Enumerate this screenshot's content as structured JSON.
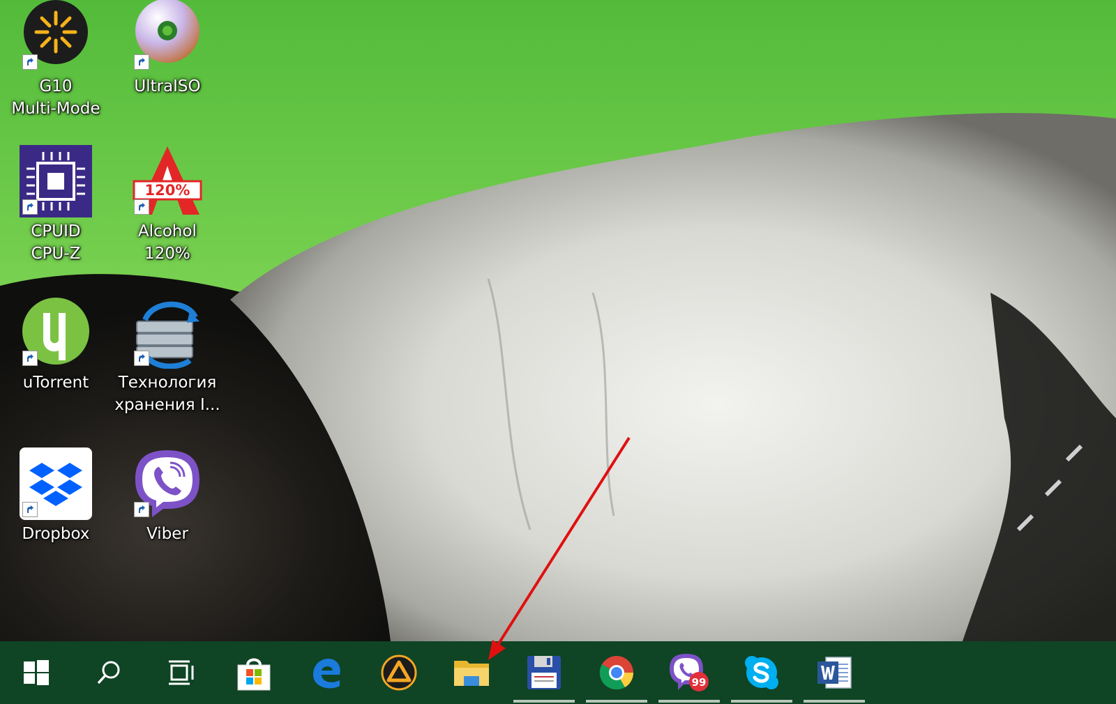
{
  "desktop_icons": [
    {
      "label": "G10\nMulti-Mode",
      "icon": "g10-multimode-icon"
    },
    {
      "label": "UltraISO",
      "icon": "ultraiso-disc-icon"
    },
    {
      "label": "CPUID\nCPU-Z",
      "icon": "cpuz-chip-icon"
    },
    {
      "label": "Alcohol\n120%",
      "icon": "alcohol-120-icon"
    },
    {
      "label": "uTorrent",
      "icon": "utorrent-icon"
    },
    {
      "label": "Технология\nхранения I...",
      "icon": "intel-storage-icon"
    },
    {
      "label": "Dropbox",
      "icon": "dropbox-icon"
    },
    {
      "label": "Viber",
      "icon": "viber-icon"
    }
  ],
  "taskbar": {
    "buttons": [
      {
        "name": "start",
        "icon": "windows-start-icon"
      },
      {
        "name": "search",
        "icon": "search-icon"
      },
      {
        "name": "task-view",
        "icon": "task-view-icon"
      },
      {
        "name": "microsoft-store",
        "icon": "store-bag-icon"
      },
      {
        "name": "edge",
        "icon": "edge-icon"
      },
      {
        "name": "aimp",
        "icon": "aimp-icon"
      },
      {
        "name": "file-explorer",
        "icon": "folder-icon"
      },
      {
        "name": "save-app",
        "icon": "floppy-disk-icon"
      },
      {
        "name": "chrome",
        "icon": "chrome-icon"
      },
      {
        "name": "viber",
        "icon": "viber-icon"
      },
      {
        "name": "skype",
        "icon": "skype-icon"
      },
      {
        "name": "word",
        "icon": "word-icon"
      }
    ],
    "viber_badge": "99"
  },
  "colors": {
    "taskbar": "#0f4424",
    "annotation_arrow": "#e01010"
  }
}
